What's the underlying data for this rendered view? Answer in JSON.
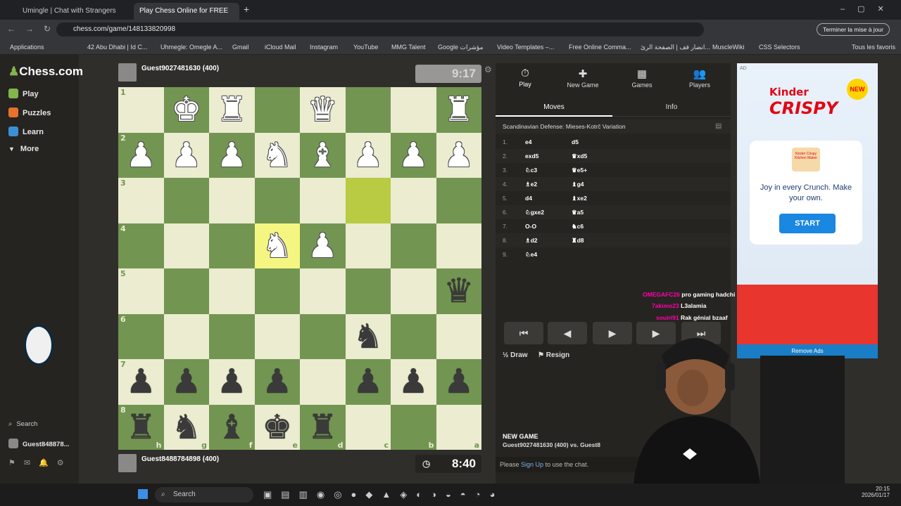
{
  "browser": {
    "tabs": [
      {
        "title": "Umingle | Chat with Strangers"
      },
      {
        "title": "Play Chess Online for FREE"
      }
    ],
    "url": "chess.com/game/148133820998",
    "update_button": "Terminer la mise à jour",
    "bookmarks": [
      "Applications",
      "42 Abu Dhabi | Id C...",
      "Uhmegle: Omegle A...",
      "Gmail",
      "iCloud Mail",
      "Instagram",
      "YouTube",
      "MMG Talent",
      "Google مؤشرات",
      "Video Templates –...",
      "Free Online Comma...",
      "انضار قف | الصفحة الرئ...",
      "MuscleWiki",
      "CSS Selectors",
      "Tous les favoris"
    ]
  },
  "sidebar": {
    "logo": "Chess.com",
    "items": [
      "Play",
      "Puzzles",
      "Learn",
      "More"
    ],
    "bottom": {
      "search": "Search",
      "user": "Guest848878..."
    }
  },
  "game": {
    "top_player": {
      "name": "Guest9027481630 (400)",
      "clock": "9:17"
    },
    "bottom_player": {
      "name": "Guest8488784898 (400)",
      "clock": "8:40"
    },
    "ranks": [
      "1",
      "2",
      "3",
      "4",
      "5",
      "6",
      "7",
      "8"
    ],
    "files": [
      "h",
      "g",
      "f",
      "e",
      "d",
      "c",
      "b",
      "a"
    ],
    "board": [
      [
        "",
        "wK",
        "wR",
        "",
        "wQ",
        "",
        "",
        "wR"
      ],
      [
        "wP",
        "wP",
        "wP",
        "wN",
        "wB",
        "wP",
        "wP",
        "wP"
      ],
      [
        "",
        "",
        "",
        "",
        "",
        "",
        "",
        ""
      ],
      [
        "",
        "",
        "",
        "wN",
        "wP",
        "",
        "",
        ""
      ],
      [
        "",
        "",
        "",
        "",
        "",
        "",
        "",
        "bQ"
      ],
      [
        "",
        "",
        "",
        "",
        "",
        "bN",
        "",
        ""
      ],
      [
        "bP",
        "bP",
        "bP",
        "bP",
        "",
        "bP",
        "bP",
        "bP"
      ],
      [
        "bR",
        "bN",
        "bB",
        "bK",
        "bR",
        "",
        "",
        ""
      ]
    ],
    "highlights": [
      [
        2,
        5
      ],
      [
        3,
        3
      ]
    ]
  },
  "panel": {
    "tabs": [
      {
        "icon": "⏱",
        "label": "Play"
      },
      {
        "icon": "✚",
        "label": "New Game"
      },
      {
        "icon": "▦",
        "label": "Games"
      },
      {
        "icon": "👥",
        "label": "Players"
      }
    ],
    "subtabs": [
      "Moves",
      "Info"
    ],
    "opening": "Scandinavian Defense: Mieses-Kotrč Variation",
    "moves": [
      {
        "n": "1.",
        "w": "e4",
        "b": "d5"
      },
      {
        "n": "2.",
        "w": "exd5",
        "b": "♛xd5"
      },
      {
        "n": "3.",
        "w": "♘c3",
        "b": "♛e5+"
      },
      {
        "n": "4.",
        "w": "♗e2",
        "b": "♝g4"
      },
      {
        "n": "5.",
        "w": "d4",
        "b": "♝xe2"
      },
      {
        "n": "6.",
        "w": "♘gxe2",
        "b": "♛a5"
      },
      {
        "n": "7.",
        "w": "O-O",
        "b": "♞c6"
      },
      {
        "n": "8.",
        "w": "♗d2",
        "b": "♜d8"
      },
      {
        "n": "9.",
        "w": "♘e4",
        "b": ""
      }
    ],
    "controls": {
      "draw": "Draw",
      "resign": "Resign"
    },
    "new_game_title": "NEW GAME",
    "new_game_detail": "Guest9027481630 (400) vs. Guest8",
    "chat_prompt_pre": "Please",
    "chat_prompt_link": "Sign Up",
    "chat_prompt_post": "to use the chat."
  },
  "stream_chat": [
    {
      "user": "OMEGAFC26",
      "msg": "pro gaming hadchi"
    },
    {
      "user": "7akimo23",
      "msg": "L3alamia"
    },
    {
      "user": "souiri91",
      "msg": "Rak génial bzaaf"
    }
  ],
  "ad": {
    "tag": "AD",
    "brand": "Kinder",
    "product": "CRISPY",
    "badge": "NEW",
    "box_label": "Kinder Crispy Kitchen Maker",
    "tagline": "Joy in every Crunch. Make your own.",
    "cta": "START",
    "remove": "Remove Ads"
  },
  "taskbar": {
    "search": "Search",
    "time": "20:15",
    "date": "2026/01/17"
  },
  "colors": {
    "light_square": "#ebecd0",
    "dark_square": "#739552",
    "accent": "#81b64c"
  }
}
